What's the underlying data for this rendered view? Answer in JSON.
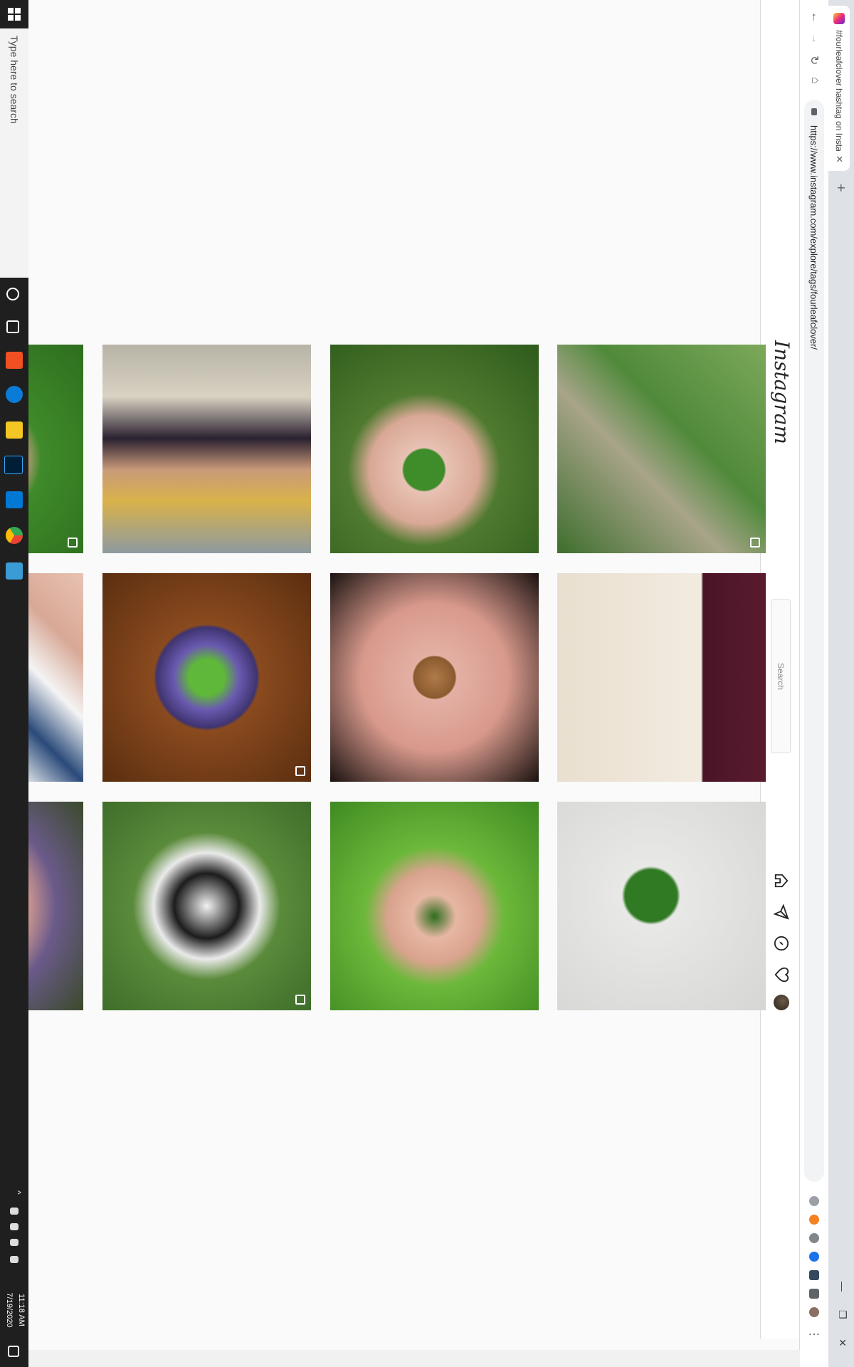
{
  "browser": {
    "tab_title": "#fourleafclover hashtag on Insta",
    "tab_close": "✕",
    "new_tab": "+",
    "window_controls": [
      "—",
      "❐",
      "✕"
    ],
    "url": "https://www.instagram.com/explore/tags/fourleafclover/",
    "nav_icons": [
      "arrow-left-icon",
      "arrow-right-icon",
      "reload-icon",
      "home-icon"
    ]
  },
  "instagram": {
    "logo": "Instagram",
    "search_placeholder": "Search",
    "nav_icons": [
      "home-icon",
      "direct-icon",
      "explore-icon",
      "heart-icon",
      "avatar"
    ]
  },
  "taskbar": {
    "search_placeholder": "Type here to search",
    "time": "11:18 AM",
    "date": "7/19/2020"
  },
  "grid": {
    "rows": [
      [
        "thumb-clover-grass-rocks",
        "thumb-hand-clover-green",
        "thumb-four-women-group",
        "thumb-hand-holding-clover-lawn"
      ],
      [
        "thumb-gold-embroidery",
        "thumb-hand-with-bullets",
        "thumb-clover-resin-paperweight",
        "thumb-hand-ring-clover-hammock"
      ],
      [
        "thumb-clover-on-white",
        "thumb-hand-clover-basil",
        "thumb-sleeping-puppy",
        "thumb-hand-clover-flowers"
      ]
    ]
  }
}
